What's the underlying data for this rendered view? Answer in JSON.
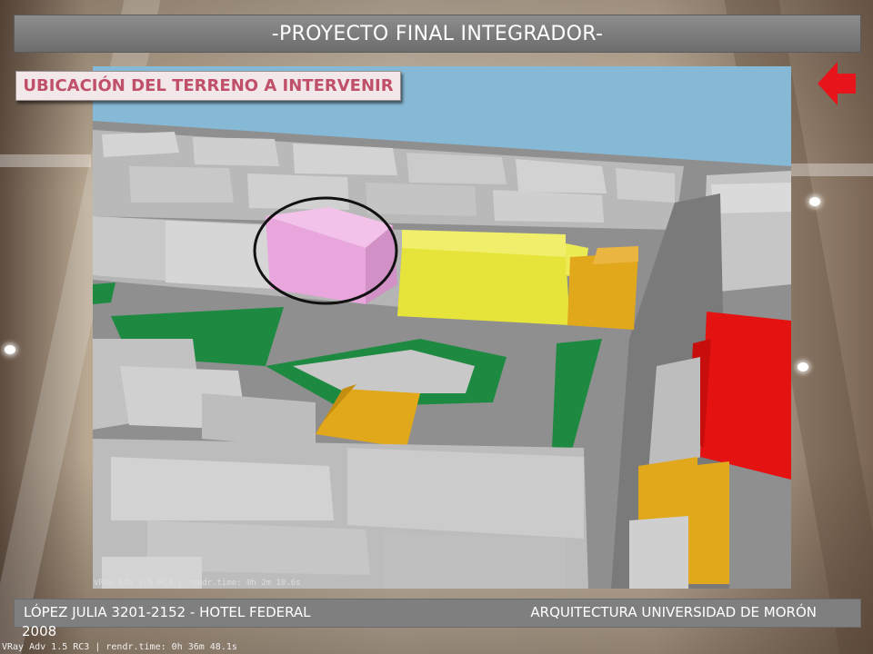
{
  "header": {
    "title": "-PROYECTO FINAL INTEGRADOR-"
  },
  "subtitle": {
    "label": "UBICACIÓN DEL TERRENO A INTERVENIR"
  },
  "back_button": {
    "icon": "arrow-left-icon",
    "color": "#e8141c"
  },
  "render": {
    "watermark": "VRay Adv 1.5 RC3 | rendr.time: 0h 2m 10.6s",
    "colors": {
      "sky": "#86b9d6",
      "building": "#c3c3c3",
      "selected_lot": "#e8a6dc",
      "highlight_yellow": "#e6e43a",
      "highlight_orange": "#e1a81b",
      "highlight_red": "#e51212",
      "park_green": "#1e8a41"
    }
  },
  "footer": {
    "left": "LÓPEZ JULIA 3201-2152 -  HOTEL FEDERAL",
    "right": "ARQUITECTURA UNIVERSIDAD DE MORÓN",
    "year": "2008"
  },
  "outer_watermark": "VRay Adv 1.5 RC3 | rendr.time: 0h 36m 48.1s"
}
